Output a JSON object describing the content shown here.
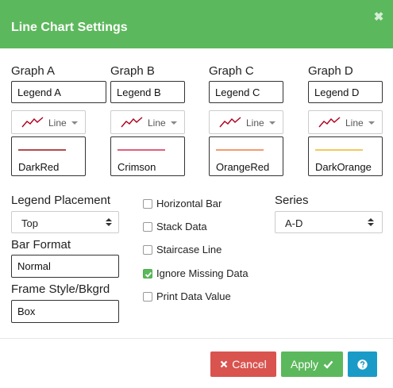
{
  "dialog": {
    "title": "Line Chart Settings",
    "close_glyph": "✖",
    "header_color": "#5cb85c"
  },
  "graphs": [
    {
      "title": "Graph A",
      "legend": "Legend A",
      "type": "Line",
      "color_name": "DarkRed",
      "swatch": "#b24b4b"
    },
    {
      "title": "Graph B",
      "legend": "Legend B",
      "type": "Line",
      "color_name": "Crimson",
      "swatch": "#e0607a"
    },
    {
      "title": "Graph C",
      "legend": "Legend C",
      "type": "Line",
      "color_name": "OrangeRed",
      "swatch": "#f39b6e"
    },
    {
      "title": "Graph D",
      "legend": "Legend D",
      "type": "Line",
      "color_name": "DarkOrange",
      "swatch": "#f2c95f"
    }
  ],
  "options": {
    "legend_placement": {
      "label": "Legend Placement",
      "value": "Top"
    },
    "bar_format": {
      "label": "Bar Format",
      "value": "Normal"
    },
    "frame_style": {
      "label": "Frame Style/Bkgrd",
      "value": "Box"
    },
    "series": {
      "label": "Series",
      "value": "A-D"
    }
  },
  "checkboxes": [
    {
      "label": "Horizontal Bar",
      "checked": false
    },
    {
      "label": "Stack Data",
      "checked": false
    },
    {
      "label": "Staircase Line",
      "checked": false
    },
    {
      "label": "Ignore Missing Data",
      "checked": true
    },
    {
      "label": "Print Data Value",
      "checked": false
    }
  ],
  "footer": {
    "cancel_label": "Cancel",
    "apply_label": "Apply",
    "cancel_color": "#d9534f",
    "apply_color": "#5cb85c",
    "help_color": "#1a9bc7",
    "icons": [
      "close-icon",
      "check-icon",
      "question-circle-icon"
    ]
  }
}
